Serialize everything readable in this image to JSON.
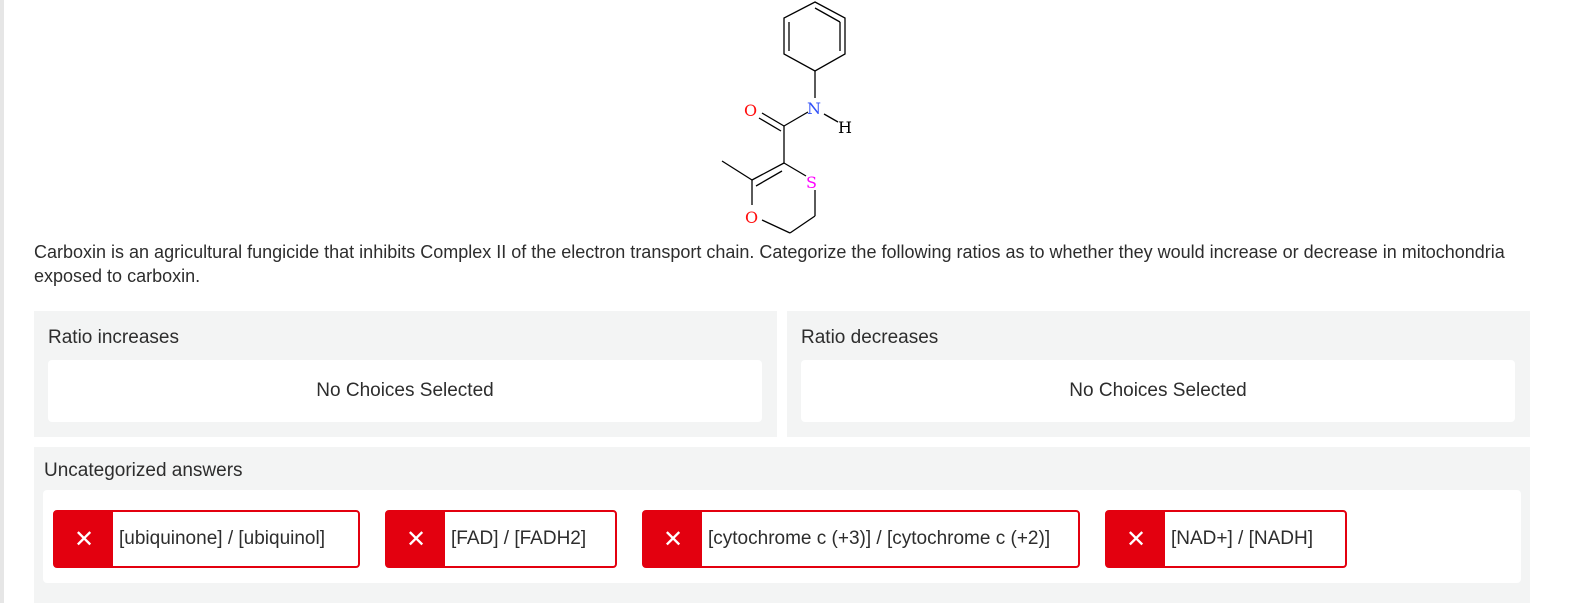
{
  "molecule": {
    "atom_labels": [
      "O",
      "N",
      "H",
      "S",
      "O"
    ]
  },
  "question": {
    "text": "Carboxin is an agricultural fungicide that inhibits Complex II of the electron transport chain.  Categorize the following ratios as to whether they would increase or decrease in mitochondria exposed to carboxin."
  },
  "categories": [
    {
      "title": "Ratio increases",
      "empty_text": "No Choices Selected"
    },
    {
      "title": "Ratio decreases",
      "empty_text": "No Choices Selected"
    }
  ],
  "uncategorized": {
    "title": "Uncategorized answers",
    "answers": [
      {
        "label": "[ubiquinone] / [ubiquinol]",
        "status": "incorrect",
        "icon": "close-icon"
      },
      {
        "label": "[FAD] / [FADH2]",
        "status": "incorrect",
        "icon": "close-icon"
      },
      {
        "label": "[cytochrome c (+3)] / [cytochrome c (+2)]",
        "status": "incorrect",
        "icon": "close-icon"
      },
      {
        "label": "[NAD+] / [NADH]",
        "status": "incorrect",
        "icon": "close-icon"
      }
    ],
    "close_glyph": "✕"
  },
  "colors": {
    "incorrect": "#e3000f",
    "panel_bg": "#f3f4f4",
    "oxygen": "#ff0d0d",
    "nitrogen": "#3050f8",
    "sulfur": "#ff00ff"
  }
}
